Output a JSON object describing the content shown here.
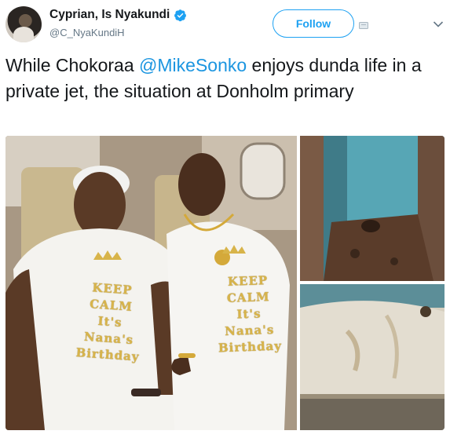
{
  "user": {
    "display_name": "Cyprian, Is Nyakundi",
    "handle": "@C_NyaKundiH"
  },
  "actions": {
    "follow_label": "Follow"
  },
  "tweet": {
    "text_before": "While Chokoraa ",
    "mention": "@MikeSonko",
    "text_after": " enjoys dunda life in a private jet, the situation at Donholm primary"
  },
  "media": {
    "left_shirt_lines": [
      "KEEP",
      "CALM",
      "It's",
      "Nana's",
      "Birthday"
    ],
    "right_shirt_lines": [
      "KEEP",
      "CALM",
      "It's",
      "Nana's",
      "Birthday"
    ]
  },
  "colors": {
    "link": "#1b95e0",
    "follow": "#1da1f2",
    "verified": "#1da1f2"
  }
}
